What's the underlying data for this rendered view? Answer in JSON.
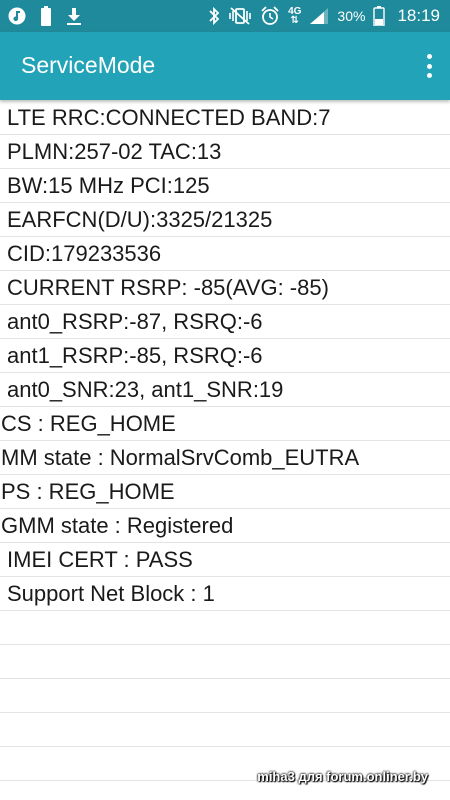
{
  "status_bar": {
    "left_icons": [
      "music-note-icon",
      "battery-saver-icon",
      "download-icon"
    ],
    "right_icons": [
      "bluetooth-icon",
      "vibrate-icon",
      "alarm-icon"
    ],
    "network_type": "4G",
    "battery": "30%",
    "time": "18:19"
  },
  "app_bar": {
    "title": "ServiceMode",
    "menu_icon": "more-vert-icon"
  },
  "rows": [
    "LTE RRC:CONNECTED BAND:7",
    "PLMN:257-02 TAC:13",
    "BW:15 MHz PCI:125",
    "EARFCN(D/U):3325/21325",
    "CID:179233536",
    "CURRENT RSRP: -85(AVG: -85)",
    "ant0_RSRP:-87, RSRQ:-6",
    "ant1_RSRP:-85, RSRQ:-6",
    "ant0_SNR:23, ant1_SNR:19",
    "CS : REG_HOME",
    "MM state : NormalSrvComb_EUTRA",
    "PS : REG_HOME",
    "GMM state : Registered",
    "IMEI CERT : PASS",
    "Support Net Block : 1",
    "",
    "",
    "",
    "",
    ""
  ],
  "watermark": "miha3 для forum.onliner.by",
  "colors": {
    "status_bar": "#1f8a9b",
    "app_bar": "#22a3b8",
    "divider": "#e3e3e3"
  }
}
